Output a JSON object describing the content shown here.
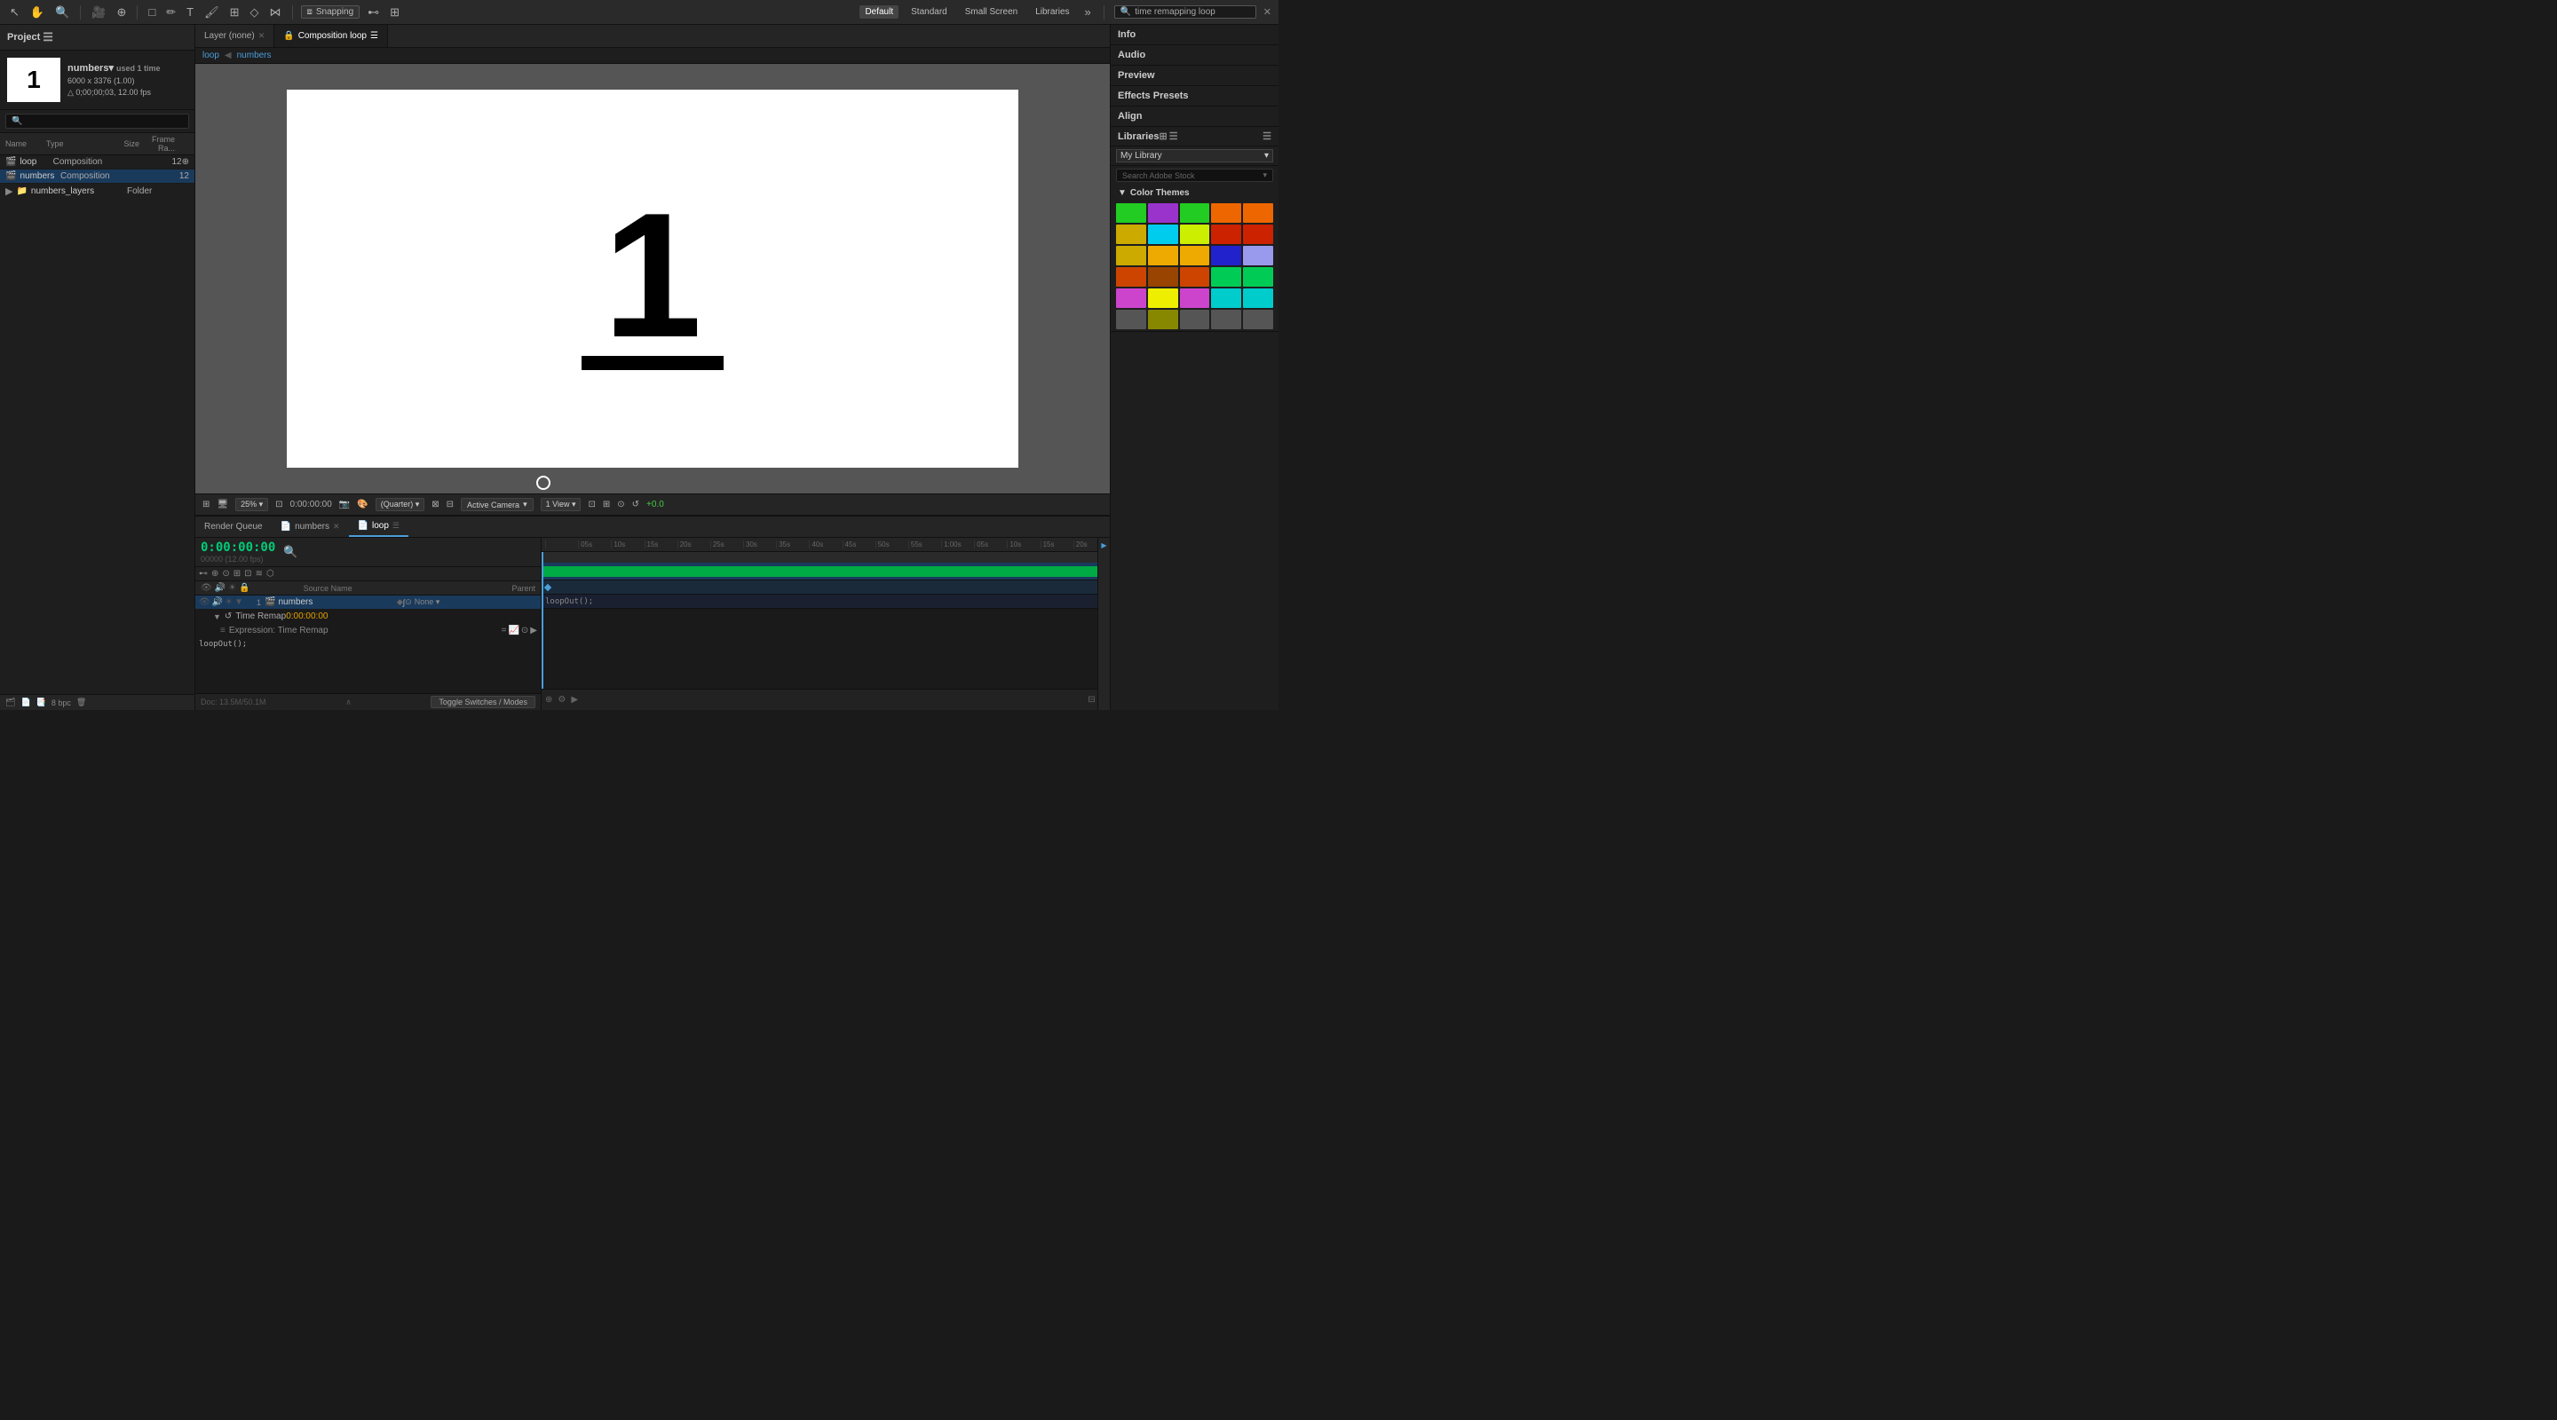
{
  "toolbar": {
    "snapping": "Snapping",
    "workspaces": [
      "Default",
      "Standard",
      "Small Screen",
      "Libraries"
    ],
    "active_workspace": "Default",
    "search_placeholder": "time remapping loop"
  },
  "project": {
    "title": "Project",
    "thumbnail_number": "1",
    "asset_name": "numbers",
    "asset_used": "used 1 time",
    "asset_dims": "6000 x 3376 (1.00)",
    "asset_duration": "△ 0;00;00;03, 12.00 fps",
    "search_placeholder": "🔍",
    "bit_depth": "8 bpc",
    "columns": {
      "name": "Name",
      "type": "Type",
      "size": "Size",
      "frame_rate": "Frame Ra..."
    },
    "files": [
      {
        "name": "loop",
        "type": "Composition",
        "size": "",
        "frame_rate": "12",
        "icon": "🎬",
        "selected": false
      },
      {
        "name": "numbers",
        "type": "Composition",
        "size": "",
        "frame_rate": "12",
        "icon": "🎬",
        "selected": true
      },
      {
        "name": "numbers_layers",
        "type": "Folder",
        "size": "",
        "frame_rate": "",
        "icon": "📁",
        "selected": false
      }
    ]
  },
  "viewer": {
    "tabs": [
      {
        "label": "Layer (none)",
        "active": false,
        "closable": true
      },
      {
        "label": "Composition loop",
        "active": true,
        "closable": false
      }
    ],
    "breadcrumbs": [
      "loop",
      "numbers"
    ],
    "zoom": "25%",
    "timecode": "0:00:00:00",
    "quality": "(Quarter)",
    "camera": "Active Camera",
    "view": "1 View",
    "offset": "+0.0",
    "canvas_number": "1"
  },
  "timeline": {
    "tabs": [
      {
        "label": "Render Queue",
        "active": false
      },
      {
        "label": "numbers",
        "active": false,
        "closable": true
      },
      {
        "label": "loop",
        "active": true,
        "closable": false
      }
    ],
    "timecode": "0:00:00:00",
    "timecode_sub": "00000 (12.00 fps)",
    "columns": {
      "source": "Source Name",
      "parent": "Parent"
    },
    "layers": [
      {
        "num": "1",
        "name": "numbers",
        "type": "comp",
        "selected": true,
        "props": [
          {
            "name": "Time Remap",
            "value": "0:00:00:00",
            "expr": "loopOut();"
          }
        ],
        "parent": "None"
      }
    ],
    "time_marks": [
      "",
      "05s",
      "10s",
      "15s",
      "20s",
      "25s",
      "30s",
      "35s",
      "40s",
      "45s",
      "50s",
      "55s",
      "1:00s",
      "05s",
      "10s",
      "15s",
      "20s"
    ],
    "toggle_label": "Toggle Switches / Modes"
  },
  "right_panel": {
    "sections": {
      "info": {
        "title": "Info"
      },
      "audio": {
        "title": "Audio"
      },
      "preview": {
        "title": "Preview"
      },
      "effects_presets": {
        "title": "Effects Presets"
      },
      "align": {
        "title": "Align"
      }
    },
    "libraries": {
      "title": "Libraries",
      "my_library": "My Library",
      "search_placeholder": "Search Adobe Stock",
      "color_themes_title": "Color Themes",
      "color_swatches": [
        "#22cc22",
        "#9933cc",
        "#22cc22",
        "#ee6600",
        "#ee6600",
        "#ccaa00",
        "#00ccee",
        "#ccee00",
        "#cc2200",
        "#cc2200",
        "#ccaa00",
        "#eeaa00",
        "#eeaa00",
        "#2222cc",
        "#9999ee",
        "#cc4400",
        "#994400",
        "#cc4400",
        "#00cc55",
        "#00cc55",
        "#cc44cc",
        "#eeee00",
        "#cc44cc",
        "#00cccc",
        "#00cccc",
        "#555555",
        "#888800",
        "#555555",
        "#555555",
        "#555555"
      ]
    }
  }
}
